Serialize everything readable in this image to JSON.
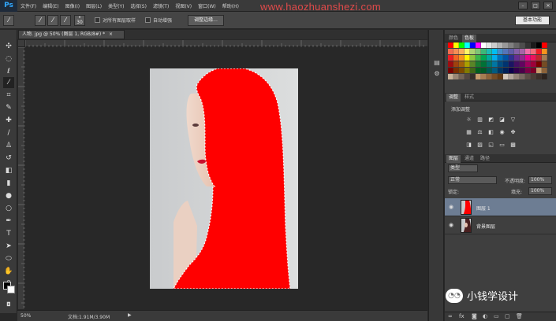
{
  "app": {
    "logo": "Ps",
    "watermark_url": "www.haozhuanshezi.com"
  },
  "menu": [
    "文件(F)",
    "编辑(E)",
    "图像(I)",
    "图层(L)",
    "类型(Y)",
    "选择(S)",
    "滤镜(T)",
    "视图(V)",
    "窗口(W)",
    "帮助(H)"
  ],
  "window_buttons": [
    "–",
    "□",
    "✕"
  ],
  "options_bar": {
    "brush_size": "30",
    "sample_all_layers": "对所有图层取样",
    "auto_enhance": "自动增强",
    "refine_edge": "调整边缘...",
    "workspace": "基本功能"
  },
  "document": {
    "tab_title": "人物. jpg @ 50% (图层 1, RGB/8#) *",
    "tab_close": "×"
  },
  "status": {
    "zoom": "50%",
    "doc_info": "文档:1.91M/3.90M",
    "arrow": "▶"
  },
  "panels": {
    "swatches_tabs": [
      "颜色",
      "色板"
    ],
    "adjust_tabs": [
      "调整",
      "样式"
    ],
    "adjust_title": "添加调整",
    "layers_tabs": [
      "图层",
      "通道",
      "路径"
    ],
    "filter_kind": "类型",
    "blend_mode": "正常",
    "opacity_label": "不透明度:",
    "opacity_value": "100%",
    "lock_label": "锁定:",
    "fill_label": "填充:",
    "fill_value": "100%",
    "layers": [
      {
        "name": "图层 1",
        "selected": true
      },
      {
        "name": "背景图层",
        "selected": false
      }
    ]
  },
  "watermark_brand": "小钱学设计",
  "colors": {
    "selection_fill": "#ff0000",
    "accent": "#31a8ff",
    "selected_layer": "#6d7d93"
  }
}
